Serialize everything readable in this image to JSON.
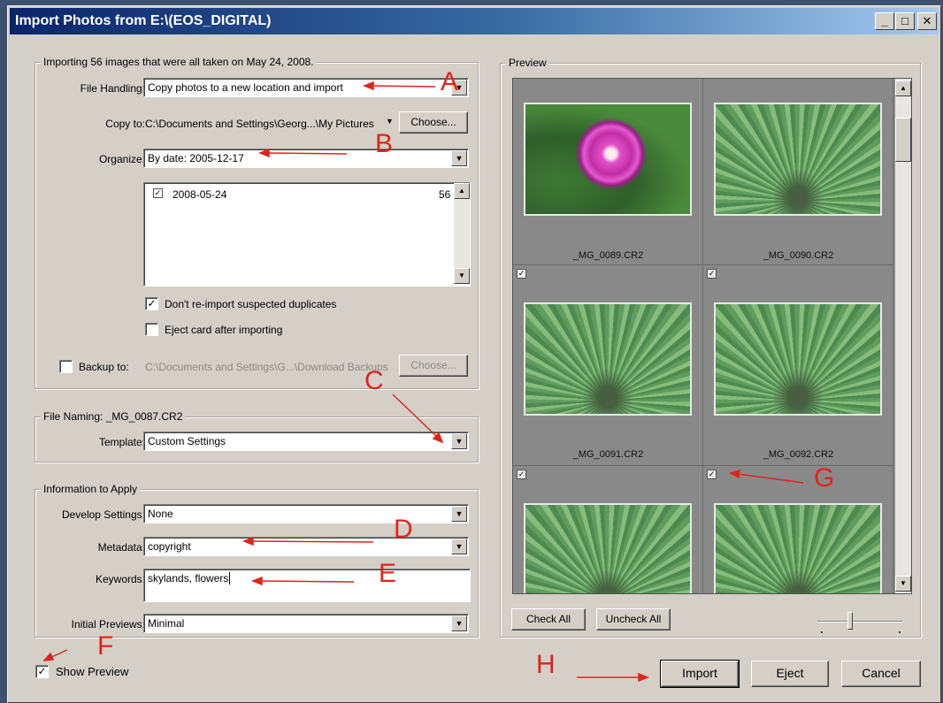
{
  "window": {
    "title": "Import Photos from E:\\(EOS_DIGITAL)",
    "controls": {
      "minimize": "_",
      "maximize": "□",
      "close": "✕"
    }
  },
  "import_group": {
    "legend": "Importing 56 images that were all taken on May 24, 2008.",
    "file_handling_label": "File Handling:",
    "file_handling_value": "Copy photos to a new location and import",
    "copy_to_label": "Copy to:",
    "copy_to_value": "C:\\Documents and Settings\\Georg...\\My Pictures",
    "choose_label": "Choose...",
    "organize_label": "Organize:",
    "organize_value": "By date: 2005-12-17",
    "folder_list": [
      {
        "name": "2008-05-24",
        "count": "56",
        "checked": true
      }
    ],
    "dont_reimport_label": "Don't re-import suspected duplicates",
    "dont_reimport_checked": true,
    "eject_label": "Eject card after importing",
    "eject_checked": false,
    "backup_label": "Backup to:",
    "backup_checked": false,
    "backup_value": "C:\\Documents and Settings\\G...\\Download Backups",
    "backup_choose_label": "Choose..."
  },
  "naming_group": {
    "legend": "File Naming:  _MG_0087.CR2",
    "template_label": "Template:",
    "template_value": "Custom Settings"
  },
  "info_group": {
    "legend": "Information to Apply",
    "develop_label": "Develop Settings:",
    "develop_value": "None",
    "metadata_label": "Metadata:",
    "metadata_value": "copyright",
    "keywords_label": "Keywords:",
    "keywords_value": "skylands, flowers",
    "previews_label": "Initial Previews:",
    "previews_value": "Minimal"
  },
  "show_preview": {
    "label": "Show Preview",
    "checked": true
  },
  "preview": {
    "legend": "Preview",
    "thumbnails": [
      {
        "filename": "_MG_0089.CR2",
        "checked": true,
        "subject": "flower"
      },
      {
        "filename": "_MG_0090.CR2",
        "checked": true,
        "subject": "fern"
      },
      {
        "filename": "_MG_0091.CR2",
        "checked": true,
        "subject": "fern"
      },
      {
        "filename": "_MG_0092.CR2",
        "checked": true,
        "subject": "fern"
      },
      {
        "filename": "",
        "checked": true,
        "subject": "fern"
      },
      {
        "filename": "",
        "checked": true,
        "subject": "fern"
      }
    ],
    "check_all_label": "Check All",
    "uncheck_all_label": "Uncheck All"
  },
  "actions": {
    "import_label": "Import",
    "eject_label": "Eject",
    "cancel_label": "Cancel"
  },
  "annotations": {
    "A": "A",
    "B": "B",
    "C": "C",
    "D": "D",
    "E": "E",
    "F": "F",
    "G": "G",
    "H": "H"
  },
  "colors": {
    "titlebar": "#0a246a",
    "dialog_bg": "#d4d0c8",
    "annotation_red": "#e0241b",
    "preview_cell_bg": "#898989"
  }
}
